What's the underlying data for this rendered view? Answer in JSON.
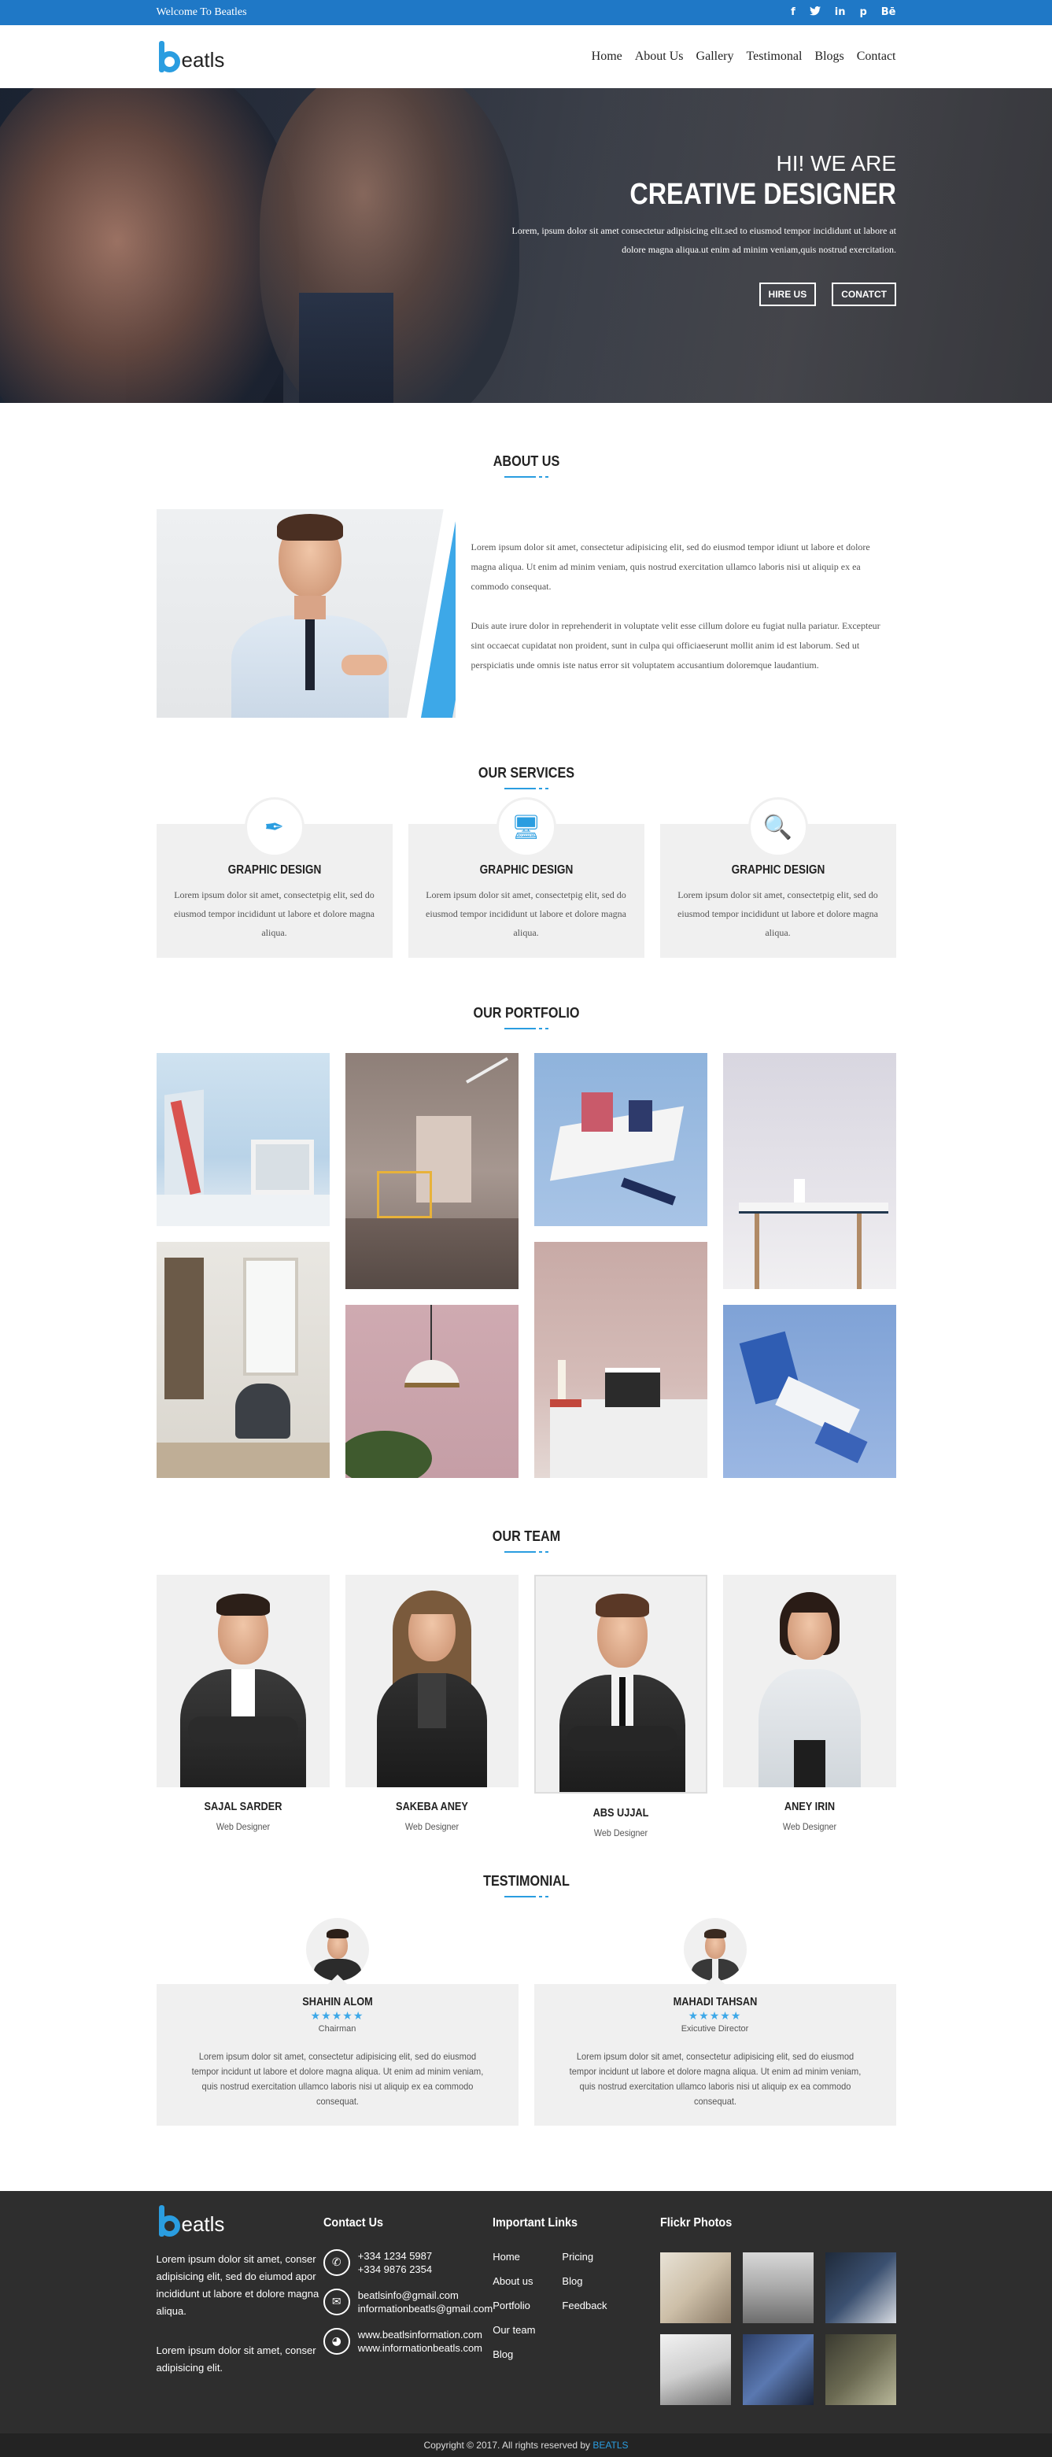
{
  "topbar": {
    "welcome": "Welcome To Beatles",
    "socials": [
      {
        "icon": "facebook-icon",
        "glyph": "f"
      },
      {
        "icon": "twitter-icon",
        "glyph": "t"
      },
      {
        "icon": "linkedin-icon",
        "glyph": "in"
      },
      {
        "icon": "pinterest-icon",
        "glyph": "p"
      },
      {
        "icon": "behance-icon",
        "glyph": "Bē"
      }
    ]
  },
  "nav": {
    "logo_text": "eatls",
    "items": [
      "Home",
      "About Us",
      "Gallery",
      "Testimonal",
      "Blogs",
      "Contact"
    ]
  },
  "hero": {
    "hi": "HI! WE ARE",
    "title": "CREATIVE DESIGNER",
    "desc": "Lorem, ipsum dolor sit amet consectetur adipisicing elit.sed to eiusmod tempor incididunt ut labore at dolore magna aliqua.ut enim ad minim veniam,quis nostrud exercitation.",
    "btn_hire": "HIRE US",
    "btn_contact": "CONATCT"
  },
  "about": {
    "heading": "ABOUT US",
    "para1": "Lorem ipsum dolor sit amet, consectetur adipisicing elit, sed do eiusmod tempor idiunt ut labore et dolore magna aliqua. Ut enim ad minim veniam, quis nostrud exercitation ullamco laboris nisi ut aliquip ex ea commodo consequat.",
    "para2": "Duis aute irure dolor in reprehenderit in voluptate velit esse cillum dolore eu fugiat nulla pariatur. Excepteur sint occaecat cupidatat non proident, sunt in culpa qui officiaeserunt mollit anim id est laborum. Sed ut perspiciatis unde omnis iste natus error sit voluptatem accusantium doloremque laudantium."
  },
  "services": {
    "heading": "OUR SERVICES",
    "items": [
      {
        "icon": "pen-tool-icon",
        "glyph": "✒",
        "title": "GRAPHIC DESIGN",
        "text": "Lorem ipsum dolor sit amet, consectetpig elit, sed do eiusmod tempor incididunt ut labore et dolore magna aliqua."
      },
      {
        "icon": "monitor-design-icon",
        "glyph": "🖥",
        "title": "GRAPHIC DESIGN",
        "text": "Lorem ipsum dolor sit amet, consectetpig elit, sed do eiusmod tempor incididunt ut labore et dolore magna aliqua."
      },
      {
        "icon": "magnifier-icon",
        "glyph": "🔍",
        "title": "GRAPHIC DESIGN",
        "text": "Lorem ipsum dolor sit amet, consectetpig elit, sed do eiusmod tempor incididunt ut labore et dolore magna aliqua."
      }
    ]
  },
  "portfolio": {
    "heading": "OUR PORTFOLIO"
  },
  "team": {
    "heading": "OUR TEAM",
    "members": [
      {
        "name": "SAJAL SARDER",
        "role": "Web Designer"
      },
      {
        "name": "SAKEBA ANEY",
        "role": "Web Designer"
      },
      {
        "name": "ABS UJJAL",
        "role": "Web Designer"
      },
      {
        "name": "ANEY IRIN",
        "role": "Web Designer"
      }
    ]
  },
  "testimonial": {
    "heading": "TESTIMONIAL",
    "items": [
      {
        "name": "SHAHIN ALOM",
        "stars": "★★★★★",
        "rating": 4.5,
        "role": "Chairman",
        "text": "Lorem ipsum dolor sit amet, consectetur adipisicing elit, sed do eiusmod tempor incidunt ut labore et dolore magna aliqua. Ut enim ad minim veniam, quis nostrud exercitation ullamco laboris nisi ut aliquip ex ea commodo consequat."
      },
      {
        "name": "MAHADI TAHSAN",
        "stars": "★★★★★",
        "rating": 4.5,
        "role": "Exicutive Director",
        "text": "Lorem ipsum dolor sit amet, consectetur adipisicing elit, sed do eiusmod tempor incidunt ut labore et dolore magna aliqua. Ut enim ad minim veniam, quis nostrud exercitation ullamco laboris nisi ut aliquip ex ea commodo consequat."
      }
    ]
  },
  "footer": {
    "logo_text": "eatls",
    "about1": "Lorem ipsum dolor sit amet, conser adipisicing elit, sed do eiumod apor incididunt ut labore et dolore magna aliqua.",
    "about2": "Lorem ipsum dolor sit amet, conser adipisicing elit.",
    "contact_heading": "Contact Us",
    "phone1": "+334 1234 5987",
    "phone2": "+334 9876 2354",
    "email1": "beatlsinfo@gmail.com",
    "email2": "informationbeatls@gmail.com",
    "web1": "www.beatlsinformation.com",
    "web2": "www.informationbeatls.com",
    "links_heading": "Important Links",
    "links_col1": [
      "Home",
      "About us",
      "Portfolio",
      "Our team",
      "Blog"
    ],
    "links_col2": [
      "Pricing",
      "Blog",
      "Feedback"
    ],
    "flickr_heading": "Flickr Photos",
    "copyright": "Copyright © 2017. All rights reserved by",
    "copyright_brand": "BEATLS"
  },
  "colors": {
    "accent": "#2a9de0",
    "topbar": "#1f78c6",
    "footer": "#2e2e2e"
  }
}
